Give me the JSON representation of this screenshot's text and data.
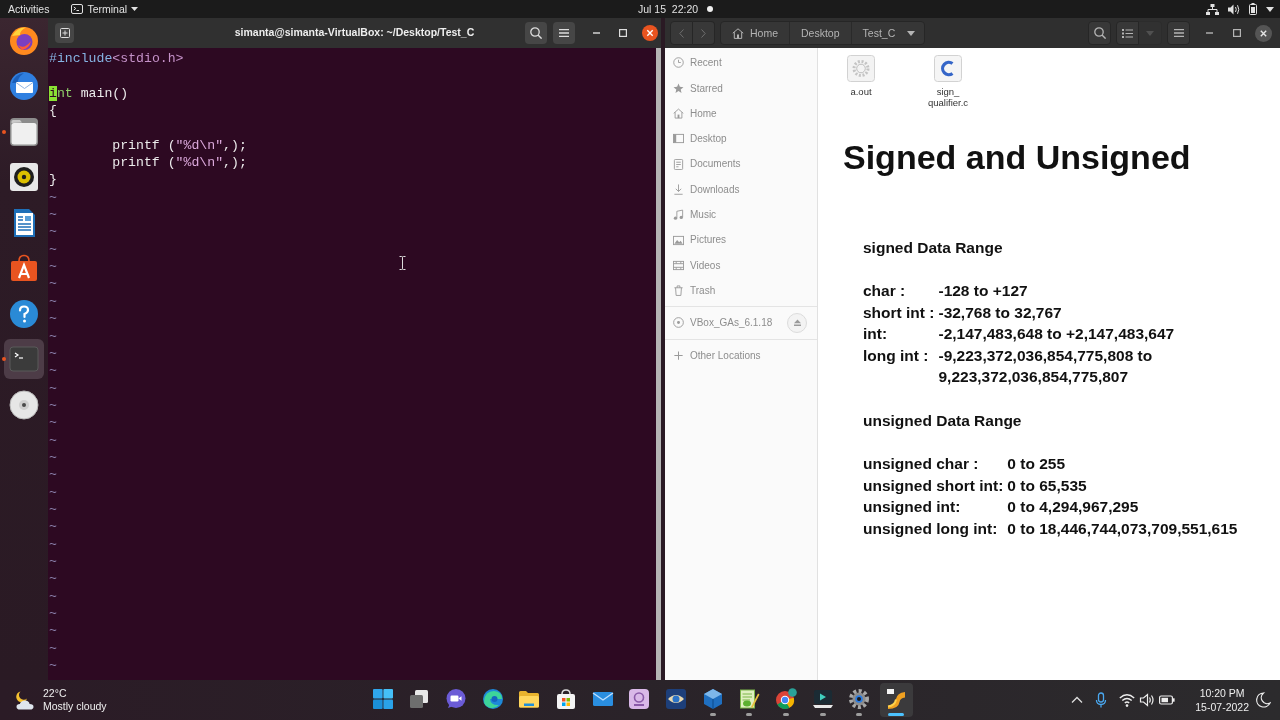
{
  "top_bar": {
    "activities": "Activities",
    "app_menu": "Terminal",
    "clock": "Jul 15  22:20"
  },
  "dock": [
    {
      "kind": "firefox",
      "running": false,
      "selected": false
    },
    {
      "kind": "thunderbird",
      "running": false,
      "selected": false
    },
    {
      "kind": "files",
      "running": true,
      "selected": false
    },
    {
      "kind": "rhythmbox",
      "running": false,
      "selected": false
    },
    {
      "kind": "writer",
      "running": false,
      "selected": false
    },
    {
      "kind": "software",
      "running": false,
      "selected": false
    },
    {
      "kind": "help",
      "running": false,
      "selected": false
    },
    {
      "kind": "terminal",
      "running": true,
      "selected": true
    },
    {
      "kind": "disc",
      "running": false,
      "selected": false
    }
  ],
  "terminal": {
    "title": "simanta@simanta-VirtualBox: ~/Desktop/Test_C",
    "lines": [
      {
        "kind": "code",
        "indented": false,
        "segments": [
          {
            "kind": "preproc",
            "text": "#include"
          },
          {
            "kind": "header",
            "text": "<stdio.h>"
          }
        ]
      },
      {
        "kind": "blank"
      },
      {
        "kind": "code",
        "indented": false,
        "segments": [
          {
            "kind": "cursor",
            "text": "i"
          },
          {
            "kind": "type",
            "text": "nt"
          },
          {
            "kind": "plain",
            "text": " main()"
          }
        ]
      },
      {
        "kind": "code",
        "indented": false,
        "segments": [
          {
            "kind": "plain",
            "text": "{"
          }
        ]
      },
      {
        "kind": "blank"
      },
      {
        "kind": "code",
        "indented": true,
        "segments": [
          {
            "kind": "plain",
            "text": "printf ("
          },
          {
            "kind": "string",
            "text": "\"%d\\n\""
          },
          {
            "kind": "plain",
            "text": ",);"
          }
        ]
      },
      {
        "kind": "code",
        "indented": true,
        "segments": [
          {
            "kind": "plain",
            "text": "printf ("
          },
          {
            "kind": "string",
            "text": "\"%d\\n\""
          },
          {
            "kind": "plain",
            "text": ",);"
          }
        ]
      },
      {
        "kind": "code",
        "indented": false,
        "segments": [
          {
            "kind": "plain",
            "text": "}"
          }
        ]
      }
    ],
    "filler": [
      "~",
      "~",
      "~",
      "~",
      "~",
      "~",
      "~",
      "~",
      "~",
      "~",
      "~",
      "~",
      "~",
      "~",
      "~",
      "~",
      "~",
      "~",
      "~",
      "~",
      "~",
      "~",
      "~",
      "~",
      "~",
      "~",
      "~",
      "~"
    ]
  },
  "file_manager": {
    "path": [
      "Home",
      "Desktop",
      "Test_C"
    ],
    "sidebar": {
      "groups": [
        {
          "items": [
            {
              "kind": "recent",
              "label": "Recent",
              "selected": false
            },
            {
              "kind": "starred",
              "label": "Starred",
              "selected": false
            },
            {
              "kind": "home",
              "label": "Home",
              "selected": false
            },
            {
              "kind": "desktop",
              "label": "Desktop",
              "selected": false
            },
            {
              "kind": "documents",
              "label": "Documents",
              "selected": false
            },
            {
              "kind": "downloads",
              "label": "Downloads",
              "selected": false
            },
            {
              "kind": "music",
              "label": "Music",
              "selected": false
            },
            {
              "kind": "pictures",
              "label": "Pictures",
              "selected": false
            },
            {
              "kind": "videos",
              "label": "Videos",
              "selected": false
            },
            {
              "kind": "trash",
              "label": "Trash",
              "selected": false
            }
          ]
        },
        {
          "items": [
            {
              "kind": "drive",
              "label": "VBox_GAs_6.1.18",
              "selected": false
            }
          ]
        },
        {
          "items": [
            {
              "kind": "other",
              "label": "Other Locations",
              "selected": false
            }
          ]
        }
      ]
    },
    "files": [
      {
        "kind": "executable",
        "name_lines": [
          "a.out"
        ],
        "selected": false
      },
      {
        "kind": "c-source",
        "name_lines": [
          "sign_",
          "qualifier.c"
        ],
        "selected": false
      }
    ],
    "slide": {
      "title": "Signed and Unsigned",
      "sections": [
        {
          "heading": "signed Data Range",
          "rows": [
            {
              "label": "char :",
              "values": [
                "-128 to +127"
              ]
            },
            {
              "label": "short int :",
              "values": [
                "-32,768 to 32,767"
              ]
            },
            {
              "label": "int:",
              "values": [
                "-2,147,483,648 to +2,147,483,647"
              ]
            },
            {
              "label": "long int :",
              "values": [
                "-9,223,372,036,854,775,808 to",
                "9,223,372,036,854,775,807"
              ]
            }
          ]
        },
        {
          "heading": "unsigned Data Range",
          "rows": [
            {
              "label": "unsigned char :",
              "values": [
                "0 to 255"
              ]
            },
            {
              "label": "unsigned short int:",
              "values": [
                "0 to 65,535"
              ]
            },
            {
              "label": "unsigned int:",
              "values": [
                "0 to 4,294,967,295"
              ]
            },
            {
              "label": "unsigned long int:",
              "values": [
                "0 to 18,446,744,073,709,551,615"
              ]
            }
          ]
        }
      ]
    }
  },
  "taskbar": {
    "weather": {
      "temperature": "22°C",
      "condition": "Mostly cloudy"
    },
    "apps": [
      {
        "kind": "start",
        "running": false,
        "selected": false
      },
      {
        "kind": "taskview",
        "running": false,
        "selected": false
      },
      {
        "kind": "chat",
        "running": false,
        "selected": false
      },
      {
        "kind": "browser",
        "running": false,
        "selected": false
      },
      {
        "kind": "folder",
        "running": false,
        "selected": false
      },
      {
        "kind": "store",
        "running": false,
        "selected": false
      },
      {
        "kind": "mail",
        "running": false,
        "selected": false
      },
      {
        "kind": "ring",
        "running": false,
        "selected": false
      },
      {
        "kind": "viewer",
        "running": false,
        "selected": false
      },
      {
        "kind": "cube",
        "running": true,
        "selected": false
      },
      {
        "kind": "notepad",
        "running": true,
        "selected": false
      },
      {
        "kind": "wheel",
        "running": true,
        "selected": false
      },
      {
        "kind": "player",
        "running": true,
        "selected": false
      },
      {
        "kind": "settings",
        "running": true,
        "selected": false
      },
      {
        "kind": "ribbon",
        "running": true,
        "selected": true
      }
    ],
    "clock": {
      "time": "10:20 PM",
      "date": "15-07-2022"
    }
  }
}
